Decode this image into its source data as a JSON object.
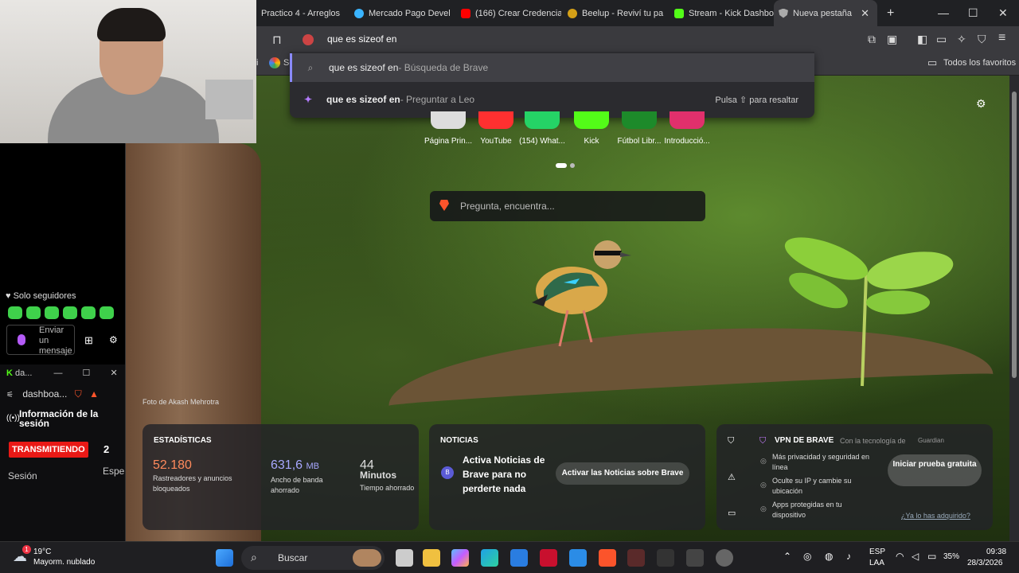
{
  "browser": {
    "tabs": [
      {
        "label": "Practico 4 - Arreglos",
        "color": "#888888"
      },
      {
        "label": "Mercado Pago Devel",
        "color": "#3ab4ff"
      },
      {
        "label": "(166) Crear Credencia",
        "color": "#ff0000"
      },
      {
        "label": "Beelup - Reviví tu pa",
        "color": "#d4a017"
      },
      {
        "label": "Stream - Kick Dashbo",
        "color": "#53fc18"
      },
      {
        "label": "Nueva pestaña",
        "color": "#aaaaaa"
      }
    ],
    "new_tab_symbol": "+",
    "address_value": "que es sizeof en",
    "suggestions": [
      {
        "icon": "search-icon",
        "bold": "que es sizeof en",
        "rest": " - Búsqueda de Brave"
      },
      {
        "icon": "leo-icon",
        "bold": "que es sizeof en",
        "rest": " - Preguntar a Leo",
        "hint": "Pulsa ⇧ para resaltar"
      }
    ],
    "bookmarks_folder": "Todos los favoritos",
    "bookmark_partial": "i",
    "bookmark_partial2": "Se"
  },
  "newtab": {
    "tiles": [
      "Página Prin...",
      "YouTube",
      "(154) What...",
      "Kick",
      "Fútbol Libr...",
      "Introducció..."
    ],
    "tile_colors": [
      "#222222",
      "#ff0000",
      "#25d366",
      "#53fc18",
      "#1d8a2a",
      "#e1306c"
    ],
    "search_placeholder": "Pregunta, encuentra...",
    "photo_credit": "Foto de Akash Mehrotra",
    "stats": {
      "title": "ESTADÍSTICAS",
      "trackers": "52.180",
      "trackers_label": "Rastreadores y anuncios bloqueados",
      "bandwidth": "631,6",
      "bandwidth_unit": "MB",
      "bandwidth_label": "Ancho de banda ahorrado",
      "time": "44",
      "time_unit": "Minutos",
      "time_label": "Tiempo ahorrado"
    },
    "news": {
      "title": "NOTICIAS",
      "text": "Activa Noticias de Brave para no perderte nada",
      "button": "Activar las Noticias sobre Brave"
    },
    "vpn": {
      "title": "VPN DE BRAVE",
      "powered": "Con la tecnología de",
      "powered_brand": "Guardian",
      "items": [
        "Más privacidad y seguridad en línea",
        "Oculte su IP y cambie su ubicación",
        "Apps protegidas en tu dispositivo"
      ],
      "button": "Iniciar prueba gratuita",
      "link": "¿Ya lo has adquirido?"
    }
  },
  "overlay": {
    "followers_only": "Solo seguidores",
    "message_placeholder": "Enviar un mensaje",
    "dash_window_title": "da...",
    "dash_tab": "dashboa...",
    "session_info": "Información de la sesión",
    "live_badge": "TRANSMITIENDO",
    "viewers": "2",
    "session_label": "Sesión",
    "session_partial": "Espe"
  },
  "taskbar": {
    "weather_temp": "19°C",
    "weather_desc": "Mayorm. nublado",
    "weather_badge": "1",
    "search_label": "Buscar",
    "lang1": "ESP",
    "lang2": "LAA",
    "battery": "35%",
    "time": "09:38",
    "date": "28/3/2026"
  }
}
